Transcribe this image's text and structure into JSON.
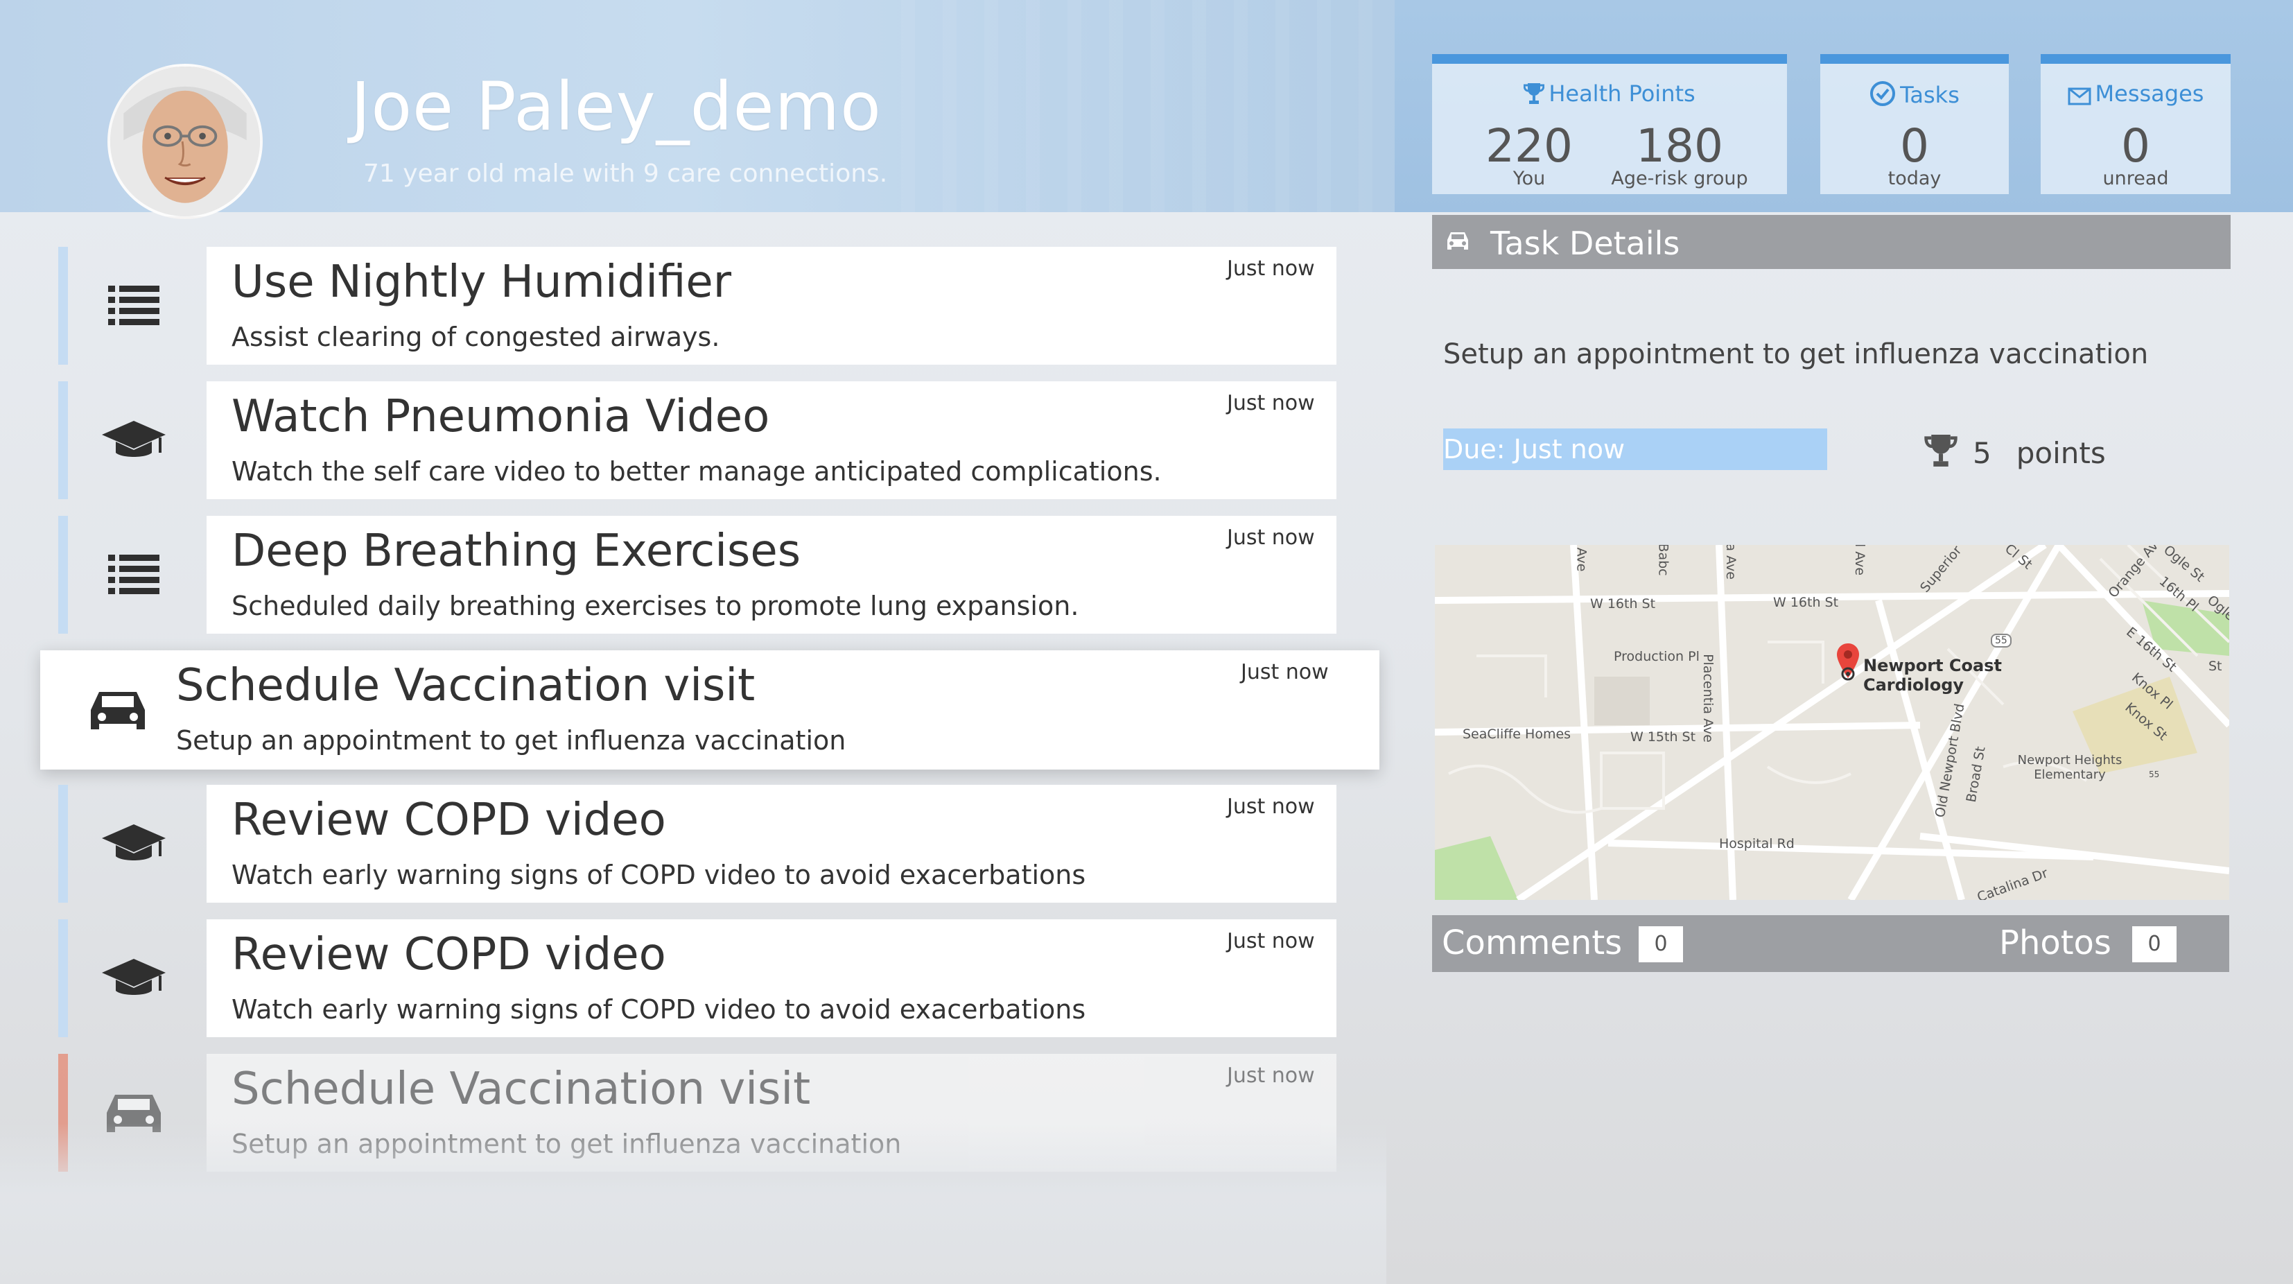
{
  "profile": {
    "name": "Joe Paley_demo",
    "subtitle": "71 year old male  with 9 care connections."
  },
  "stats": {
    "health_points": {
      "title": "Health Points",
      "icon": "trophy-icon",
      "you_value": "220",
      "you_label": "You",
      "group_value": "180",
      "group_label": "Age-risk group"
    },
    "tasks": {
      "title": "Tasks",
      "icon": "check-circle-icon",
      "value": "0",
      "label": "today"
    },
    "messages": {
      "title": "Messages",
      "icon": "envelope-icon",
      "value": "0",
      "label": "unread"
    }
  },
  "tasks": [
    {
      "title": "Use Nightly Humidifier",
      "desc": "Assist clearing of congested airways.",
      "time": "Just now",
      "icon": "list-icon",
      "accent": "#c5dcf3"
    },
    {
      "title": "Watch Pneumonia Video",
      "desc": "Watch the self care video to better manage anticipated complications.",
      "time": "Just now",
      "icon": "graduation-cap-icon",
      "accent": "#c5dcf3"
    },
    {
      "title": "Deep Breathing Exercises",
      "desc": "Scheduled daily breathing exercises to promote lung expansion.",
      "time": "Just now",
      "icon": "list-icon",
      "accent": "#c5dcf3"
    },
    {
      "title": "Schedule Vaccination visit",
      "desc": "Setup an appointment to get influenza vaccination",
      "time": "Just now",
      "icon": "car-icon",
      "accent": "#ffffff"
    },
    {
      "title": "Review COPD video",
      "desc": "Watch early warning signs of COPD video to avoid exacerbations",
      "time": "Just now",
      "icon": "graduation-cap-icon",
      "accent": "#c5dcf3"
    },
    {
      "title": "Review COPD video",
      "desc": "Watch early warning signs of COPD video to avoid exacerbations",
      "time": "Just now",
      "icon": "graduation-cap-icon",
      "accent": "#c5dcf3"
    },
    {
      "title": "Schedule Vaccination visit",
      "desc": "Setup an appointment to get influenza vaccination",
      "time": "Just now",
      "icon": "car-icon",
      "accent": "#e8674a"
    }
  ],
  "detail": {
    "header": "Task Details",
    "header_icon": "car-icon",
    "description": "Setup an appointment to get influenza vaccination",
    "due": "Due: Just now",
    "points_value": "5",
    "points_label": "points",
    "comments_label": "Comments",
    "comments_count": "0",
    "photos_label": "Photos",
    "photos_count": "0"
  },
  "map": {
    "place": "Newport Coast Cardiology",
    "labels": [
      "W 16th St",
      "W 16th St",
      "Production Pl",
      "SeaCliffe Homes",
      "W 15th St",
      "Placentia Ave",
      "Hospital Rd",
      "Old Newport Blvd",
      "Broad St",
      "Newport Heights Elementary",
      "E 16th St",
      "Knox Pl",
      "Knox St",
      "16th Pl",
      "Orange Ave",
      "Ogle St",
      "Ogle",
      "Superior",
      "Catalina Dr",
      "55",
      "Ave",
      "Babc",
      "ia Ave",
      "l Ave",
      "Cl St",
      "St",
      "55"
    ]
  },
  "colors": {
    "accent_blue": "#4a97dd",
    "header_bg": "#bcd3ea",
    "bar_grey": "#9d9fa3",
    "due_blue": "#aad1f6",
    "pin_red": "#e8453c"
  }
}
